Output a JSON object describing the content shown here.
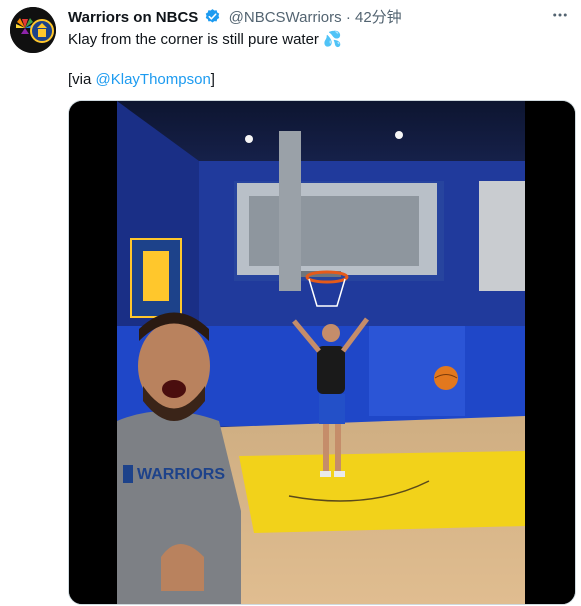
{
  "tweet": {
    "author_name": "Warriors on NBCS",
    "handle": "@NBCSWarriors",
    "separator": "·",
    "time": "42分钟",
    "more_icon": "more-dots-icon",
    "verified_icon": "verified-badge-icon",
    "text": "Klay from the corner is still pure water",
    "emoji": "💦",
    "via_prefix": "[via ",
    "via_mention": "@KlayThompson",
    "via_suffix": "]"
  },
  "video": {
    "jersey_text": "WARRIORS",
    "colors": {
      "wall_blue": "#1e3a9a",
      "court_yellow": "#f2d21a",
      "floor_wood": "#d9b487",
      "accent_blue": "#1d9bf0"
    }
  }
}
